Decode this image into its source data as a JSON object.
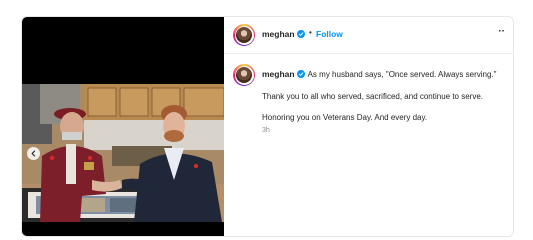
{
  "post": {
    "username": "meghan",
    "follow_label": "Follow",
    "separator": "•",
    "more_label": "··",
    "caption_main": "As my husband says, \"Once served. Always serving.\"",
    "paragraph_1": "Thank you to all who served, sacrificed, and continue to serve.",
    "paragraph_2": "Honoring you on Veterans Day. And every day.",
    "timestamp": "3h"
  },
  "icons": {
    "verified": "verified-badge-icon",
    "carousel_prev": "chevron-left-icon",
    "more": "more-options-icon"
  },
  "colors": {
    "accent": "#0095f6",
    "text": "#262626",
    "muted": "#8e8e8e",
    "media_background": "#000000"
  }
}
